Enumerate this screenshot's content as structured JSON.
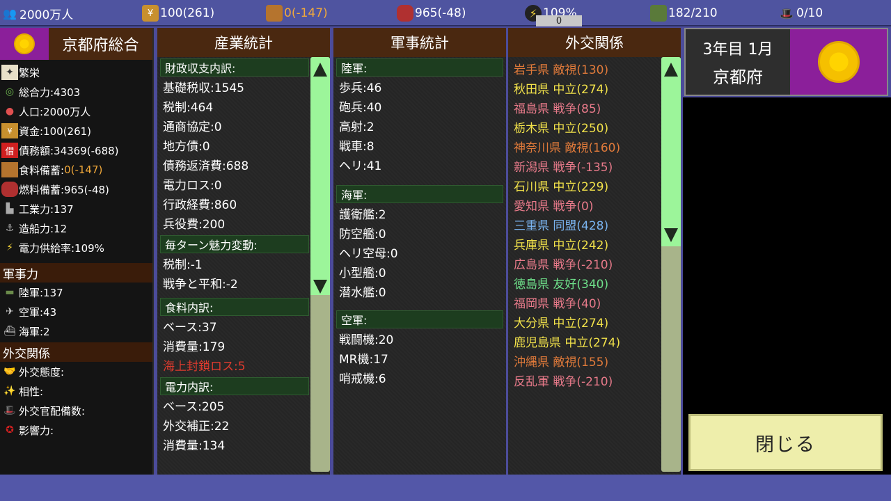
{
  "topbar": {
    "population": "2000万人",
    "funds": "100(261)",
    "food": "0(-147)",
    "fuel": "965(-48)",
    "power": "109%",
    "troops": "182/210",
    "diplomats": "0/10",
    "map_label": "0"
  },
  "left": {
    "title": "京都府総合",
    "rows": [
      {
        "icon": "prosperity-icon",
        "text": "繁栄"
      },
      {
        "icon": "total-power-icon",
        "text": "総合力:4303"
      },
      {
        "icon": "population-icon",
        "text": "人口:2000万人"
      },
      {
        "icon": "funds-icon",
        "text": "資金:100(261)"
      },
      {
        "icon": "debt-icon",
        "icon_text": "借",
        "text": "債務額:34369(-688)"
      },
      {
        "icon": "food-icon",
        "text": "食料備蓄:",
        "text_value": "0(-147)"
      },
      {
        "icon": "fuel-icon",
        "text": "燃料備蓄:965(-48)"
      },
      {
        "icon": "industry-icon",
        "text": "工業力:137"
      },
      {
        "icon": "shipbuilding-icon",
        "text": "造船力:12"
      },
      {
        "icon": "power-supply-icon",
        "text": "電力供給率:109%"
      }
    ],
    "military_section": "軍事力",
    "military": [
      {
        "icon": "tank-icon",
        "text": "陸軍:137"
      },
      {
        "icon": "jet-icon",
        "text": "空軍:43"
      },
      {
        "icon": "ship-icon",
        "text": "海軍:2"
      }
    ],
    "diplomacy_section": "外交関係",
    "diplomacy": [
      {
        "icon": "handshake-icon",
        "text": "外交態度:"
      },
      {
        "icon": "sparkle-icon",
        "text": "相性:"
      },
      {
        "icon": "diplomat-icon",
        "text": "外交官配備数:"
      },
      {
        "icon": "influence-icon",
        "text": "影響力:"
      }
    ]
  },
  "industry": {
    "title": "産業統計",
    "sections": [
      {
        "head": "財政収支内訳:",
        "rows": [
          "基礎税収:1545",
          "税制:464",
          "通商協定:0",
          "地方債:0",
          "債務返済費:688",
          "電力ロス:0",
          "行政経費:860",
          "兵役費:200"
        ]
      },
      {
        "head": "毎ターン魅力変動:",
        "rows": [
          "税制:-1",
          "戦争と平和:-2"
        ]
      },
      {
        "head": "食料内訳:",
        "rows": [
          "ベース:37",
          "消費量:179",
          "海上封鎖ロス:5"
        ]
      },
      {
        "head": "電力内訳:",
        "rows": [
          "ベース:205",
          "外交補正:22",
          "消費量:134"
        ]
      }
    ]
  },
  "military": {
    "title": "軍事統計",
    "sections": [
      {
        "head": "陸軍:",
        "rows": [
          "歩兵:46",
          "砲兵:40",
          "高射:2",
          "戦車:8",
          "ヘリ:41"
        ]
      },
      {
        "head": "海軍:",
        "rows": [
          "護衛艦:2",
          "防空艦:0",
          "ヘリ空母:0",
          "小型艦:0",
          "潜水艦:0"
        ]
      },
      {
        "head": "空軍:",
        "rows": [
          "戦闘機:20",
          "MR機:17",
          "哨戒機:6"
        ]
      }
    ]
  },
  "diplomacy": {
    "title": "外交関係",
    "rows": [
      {
        "text": "岩手県 敵視(130)",
        "color": "#e07a3a"
      },
      {
        "text": "秋田県 中立(274)",
        "color": "#f2e24a"
      },
      {
        "text": "福島県 戦争(85)",
        "color": "#e87a8a"
      },
      {
        "text": "栃木県 中立(250)",
        "color": "#f2e24a"
      },
      {
        "text": "神奈川県 敵視(160)",
        "color": "#e07a3a"
      },
      {
        "text": "新潟県 戦争(-135)",
        "color": "#e87a8a"
      },
      {
        "text": "石川県 中立(229)",
        "color": "#f2e24a"
      },
      {
        "text": "愛知県 戦争(0)",
        "color": "#e87a8a"
      },
      {
        "text": "三重県 同盟(428)",
        "color": "#7ab4f0"
      },
      {
        "text": "兵庫県 中立(242)",
        "color": "#f2e24a"
      },
      {
        "text": "広島県 戦争(-210)",
        "color": "#e87a8a"
      },
      {
        "text": "徳島県 友好(340)",
        "color": "#6ee08a"
      },
      {
        "text": "福岡県 戦争(40)",
        "color": "#e87a8a"
      },
      {
        "text": "大分県 中立(274)",
        "color": "#f2e24a"
      },
      {
        "text": "鹿児島県 中立(274)",
        "color": "#f2e24a"
      },
      {
        "text": "沖縄県 敵視(155)",
        "color": "#e07a3a"
      },
      {
        "text": "反乱軍 戦争(-210)",
        "color": "#e87a8a"
      }
    ]
  },
  "date": {
    "turn": "3年目 1月",
    "prefecture": "京都府"
  },
  "close_label": "閉じる"
}
